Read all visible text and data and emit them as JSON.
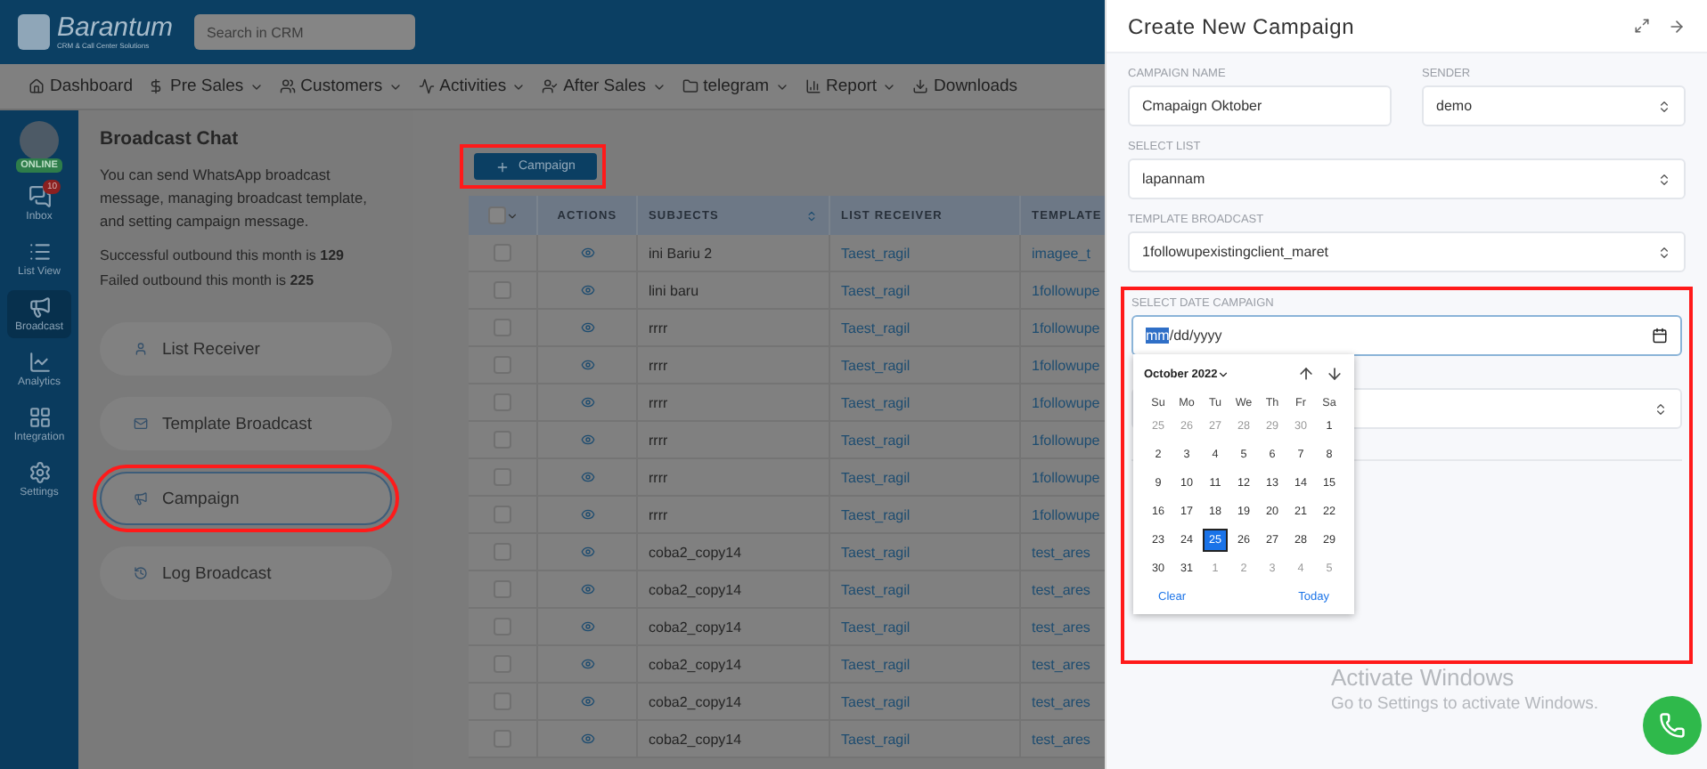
{
  "header": {
    "logo": {
      "name": "Barantum",
      "tagline": "CRM & Call Center Solutions"
    },
    "search": {
      "placeholder": "Search in CRM"
    }
  },
  "nav": [
    {
      "label": "Dashboard",
      "dropdown": false
    },
    {
      "label": "Pre Sales",
      "dropdown": true
    },
    {
      "label": "Customers",
      "dropdown": true
    },
    {
      "label": "Activities",
      "dropdown": true
    },
    {
      "label": "After Sales",
      "dropdown": true
    },
    {
      "label": "telegram",
      "dropdown": true
    },
    {
      "label": "Report",
      "dropdown": true
    },
    {
      "label": "Downloads",
      "dropdown": false
    }
  ],
  "sidebar": {
    "status": "ONLINE",
    "items": [
      {
        "label": "Inbox",
        "badge": "10",
        "selected": false
      },
      {
        "label": "List View",
        "selected": false
      },
      {
        "label": "Broadcast",
        "selected": true
      },
      {
        "label": "Analytics",
        "selected": false
      },
      {
        "label": "Integration",
        "selected": false
      },
      {
        "label": "Settings",
        "selected": false
      }
    ]
  },
  "broadcast": {
    "title": "Broadcast Chat",
    "description": "You can send WhatsApp broadcast message, managing broadcast template, and setting campaign message.",
    "stats": [
      "Successful outbound this month is **129**",
      "Failed outbound this month is **225**"
    ],
    "menu": [
      {
        "label": "List Receiver",
        "selected": false,
        "highlighted": false
      },
      {
        "label": "Template Broadcast",
        "selected": false,
        "highlighted": false
      },
      {
        "label": "Campaign",
        "selected": true,
        "highlighted": true
      },
      {
        "label": "Log Broadcast",
        "selected": false,
        "highlighted": false
      }
    ]
  },
  "add_button": {
    "label": "Campaign",
    "highlighted": true
  },
  "table": {
    "all_checked": false,
    "columns": [
      "ACTIONS",
      "SUBJECTS",
      "LIST RECEIVER",
      "TEMPLATE"
    ],
    "rows": [
      {
        "checked": false,
        "subject": "ini Bariu 2",
        "receiver": "Taest_ragil",
        "template": "imagee_t"
      },
      {
        "checked": false,
        "subject": "lini baru",
        "receiver": "Taest_ragil",
        "template": "1followupe"
      },
      {
        "checked": false,
        "subject": "rrrr",
        "receiver": "Taest_ragil",
        "template": "1followupe"
      },
      {
        "checked": false,
        "subject": "rrrr",
        "receiver": "Taest_ragil",
        "template": "1followupe"
      },
      {
        "checked": false,
        "subject": "rrrr",
        "receiver": "Taest_ragil",
        "template": "1followupe"
      },
      {
        "checked": false,
        "subject": "rrrr",
        "receiver": "Taest_ragil",
        "template": "1followupe"
      },
      {
        "checked": false,
        "subject": "rrrr",
        "receiver": "Taest_ragil",
        "template": "1followupe"
      },
      {
        "checked": false,
        "subject": "rrrr",
        "receiver": "Taest_ragil",
        "template": "1followupe"
      },
      {
        "checked": false,
        "subject": "coba2_copy14",
        "receiver": "Taest_ragil",
        "template": "test_ares"
      },
      {
        "checked": false,
        "subject": "coba2_copy14",
        "receiver": "Taest_ragil",
        "template": "test_ares"
      },
      {
        "checked": false,
        "subject": "coba2_copy14",
        "receiver": "Taest_ragil",
        "template": "test_ares"
      },
      {
        "checked": false,
        "subject": "coba2_copy14",
        "receiver": "Taest_ragil",
        "template": "test_ares"
      },
      {
        "checked": false,
        "subject": "coba2_copy14",
        "receiver": "Taest_ragil",
        "template": "test_ares"
      },
      {
        "checked": false,
        "subject": "coba2_copy14",
        "receiver": "Taest_ragil",
        "template": "test_ares"
      }
    ]
  },
  "panel": {
    "title": "Create New Campaign",
    "fields": [
      {
        "kind": "input",
        "label": "CAMPAIGN NAME",
        "value": "Cmapaign Oktober",
        "half": true
      },
      {
        "kind": "select",
        "label": "SENDER",
        "value": "demo",
        "half": true
      },
      {
        "kind": "select",
        "label": "SELECT LIST",
        "value": "lapannam",
        "half": false
      },
      {
        "kind": "select",
        "label": "TEMPLATE BROADCAST",
        "value": "1followupexistingclient_maret",
        "half": false
      }
    ],
    "date_field": {
      "label": "SELECT DATE CAMPAIGN",
      "highlighted": true,
      "segments": [
        {
          "text": "mm",
          "selected": true
        },
        {
          "text": "/",
          "selected": false
        },
        {
          "text": "dd",
          "selected": false
        },
        {
          "text": "/",
          "selected": false
        },
        {
          "text": "yyyy",
          "selected": false
        }
      ]
    },
    "calendar": {
      "month": "October 2022",
      "weekdays": [
        "Su",
        "Mo",
        "Tu",
        "We",
        "Th",
        "Fr",
        "Sa"
      ],
      "weeks": [
        [
          {
            "day": "25",
            "muted": true,
            "selected": false
          },
          {
            "day": "26",
            "muted": true,
            "selected": false
          },
          {
            "day": "27",
            "muted": true,
            "selected": false
          },
          {
            "day": "28",
            "muted": true,
            "selected": false
          },
          {
            "day": "29",
            "muted": true,
            "selected": false
          },
          {
            "day": "30",
            "muted": true,
            "selected": false
          },
          {
            "day": "1",
            "muted": false,
            "selected": false
          }
        ],
        [
          {
            "day": "2",
            "muted": false,
            "selected": false
          },
          {
            "day": "3",
            "muted": false,
            "selected": false
          },
          {
            "day": "4",
            "muted": false,
            "selected": false
          },
          {
            "day": "5",
            "muted": false,
            "selected": false
          },
          {
            "day": "6",
            "muted": false,
            "selected": false
          },
          {
            "day": "7",
            "muted": false,
            "selected": false
          },
          {
            "day": "8",
            "muted": false,
            "selected": false
          }
        ],
        [
          {
            "day": "9",
            "muted": false,
            "selected": false
          },
          {
            "day": "10",
            "muted": false,
            "selected": false
          },
          {
            "day": "11",
            "muted": false,
            "selected": false
          },
          {
            "day": "12",
            "muted": false,
            "selected": false
          },
          {
            "day": "13",
            "muted": false,
            "selected": false
          },
          {
            "day": "14",
            "muted": false,
            "selected": false
          },
          {
            "day": "15",
            "muted": false,
            "selected": false
          }
        ],
        [
          {
            "day": "16",
            "muted": false,
            "selected": false
          },
          {
            "day": "17",
            "muted": false,
            "selected": false
          },
          {
            "day": "18",
            "muted": false,
            "selected": false
          },
          {
            "day": "19",
            "muted": false,
            "selected": false
          },
          {
            "day": "20",
            "muted": false,
            "selected": false
          },
          {
            "day": "21",
            "muted": false,
            "selected": false
          },
          {
            "day": "22",
            "muted": false,
            "selected": false
          }
        ],
        [
          {
            "day": "23",
            "muted": false,
            "selected": false
          },
          {
            "day": "24",
            "muted": false,
            "selected": false
          },
          {
            "day": "25",
            "muted": false,
            "selected": true
          },
          {
            "day": "26",
            "muted": false,
            "selected": false
          },
          {
            "day": "27",
            "muted": false,
            "selected": false
          },
          {
            "day": "28",
            "muted": false,
            "selected": false
          },
          {
            "day": "29",
            "muted": false,
            "selected": false
          }
        ],
        [
          {
            "day": "30",
            "muted": false,
            "selected": false
          },
          {
            "day": "31",
            "muted": false,
            "selected": false
          },
          {
            "day": "1",
            "muted": true,
            "selected": false
          },
          {
            "day": "2",
            "muted": true,
            "selected": false
          },
          {
            "day": "3",
            "muted": true,
            "selected": false
          },
          {
            "day": "4",
            "muted": true,
            "selected": false
          },
          {
            "day": "5",
            "muted": true,
            "selected": false
          }
        ]
      ],
      "clear": "Clear",
      "today": "Today"
    }
  },
  "os_notice": {
    "title": "Activate Windows",
    "subtitle": "Go to Settings to activate Windows."
  }
}
